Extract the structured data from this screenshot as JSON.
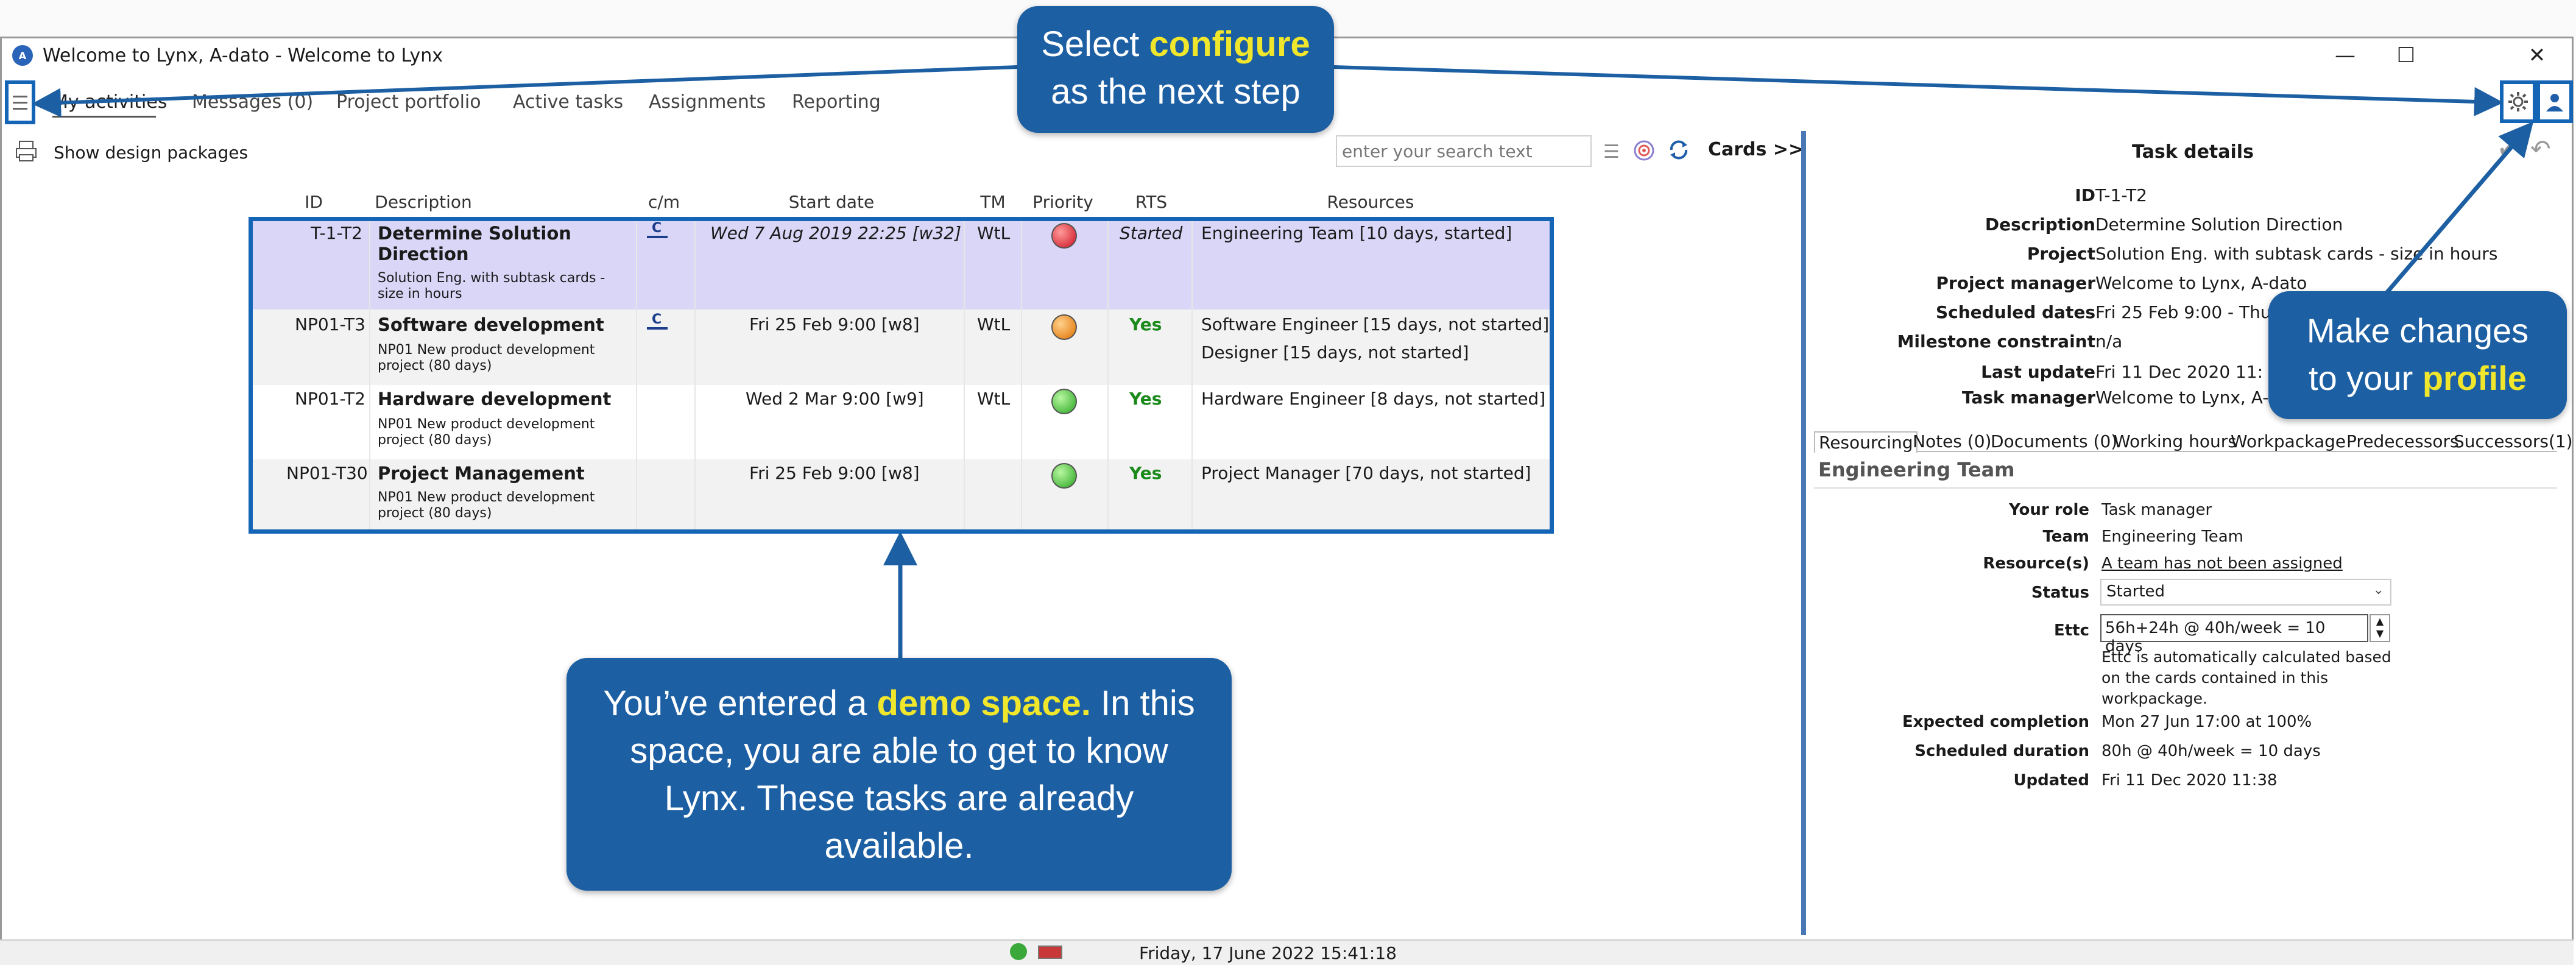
{
  "window": {
    "title": "Welcome to Lynx, A-dato - Welcome to Lynx",
    "logo": "lynx-logo",
    "controls": [
      "minimize-icon",
      "maximize-icon",
      "close-icon"
    ]
  },
  "tabs": [
    "My activities",
    "Messages (0)",
    "Project portfolio",
    "Active tasks",
    "Assignments",
    "Reporting"
  ],
  "toolbar": {
    "show_design_packages": "Show design packages",
    "search_placeholder": "enter your search text",
    "cards_link": "Cards >>"
  },
  "table": {
    "headers": [
      "ID",
      "Description",
      "c/m",
      "Start date",
      "TM",
      "Priority",
      "RTS",
      "Resources"
    ],
    "rows": [
      {
        "id": "T-1-T2",
        "title": "Determine Solution Direction",
        "subtitle": "Solution Eng. with subtask cards - size in hours",
        "cm": "C",
        "start": "Wed 7 Aug 2019 22:25 [w32]",
        "tm": "WtL",
        "priority": "red",
        "rts": "Started",
        "resources": [
          "Engineering Team [10 days, started]"
        ]
      },
      {
        "id": "NP01-T3",
        "title": "Software development",
        "subtitle": "NP01 New product development project (80 days)",
        "cm": "C",
        "start": "Fri 25 Feb 9:00 [w8]",
        "tm": "WtL",
        "priority": "orange",
        "rts": "Yes",
        "resources": [
          "Software Engineer [15 days, not started]",
          "Designer [15 days, not started]"
        ]
      },
      {
        "id": "NP01-T2",
        "title": "Hardware development",
        "subtitle": "NP01 New product development project (80 days)",
        "cm": "",
        "start": "Wed 2 Mar 9:00 [w9]",
        "tm": "WtL",
        "priority": "green",
        "rts": "Yes",
        "resources": [
          "Hardware Engineer [8 days, not started]"
        ]
      },
      {
        "id": "NP01-T30",
        "title": "Project Management",
        "subtitle": "NP01 New product development project (80 days)",
        "cm": "",
        "start": "Fri 25 Feb 9:00 [w8]",
        "tm": "",
        "priority": "green",
        "rts": "Yes",
        "resources": [
          "Project Manager [70 days, not started]"
        ]
      }
    ]
  },
  "details": {
    "title": "Task details",
    "fields": [
      {
        "label": "ID",
        "value": "T-1-T2"
      },
      {
        "label": "Description",
        "value": "Determine Solution Direction"
      },
      {
        "label": "Project",
        "value": "Solution Eng. with subtask cards - size in hours"
      },
      {
        "label": "Project manager",
        "value": "Welcome to Lynx, A-dato"
      },
      {
        "label": "Scheduled dates",
        "value": "Fri 25 Feb 9:00 - Thu 10"
      },
      {
        "label": "Milestone constraint",
        "value": "n/a"
      },
      {
        "label": "Last update",
        "value": "Fri 11 Dec 2020 11:"
      },
      {
        "label": "Task manager",
        "value": "Welcome to Lynx, A-da"
      }
    ],
    "subtabs": [
      "Resourcing",
      "Notes (0)",
      "Documents (0)",
      "Working hours",
      "Workpackage",
      "Predecessors",
      "Successors(1)"
    ],
    "team_heading": "Engineering Team",
    "resourcing": {
      "your_role_label": "Your role",
      "your_role": "Task manager",
      "team_label": "Team",
      "team": "Engineering Team",
      "resources_label": "Resource(s)",
      "resources": "A team has not been assigned",
      "status_label": "Status",
      "status": "Started",
      "ettc_label": "Ettc",
      "ettc": "56h+24h @ 40h/week = 10 days",
      "ettc_note": "Ettc is automatically calculated based on the cards contained in this workpackage.",
      "expected_label": "Expected completion",
      "expected": "Mon 27 Jun 17:00 at 100%",
      "scheduled_label": "Scheduled duration",
      "scheduled": "80h @ 40h/week = 10 days",
      "updated_label": "Updated",
      "updated": "Fri 11 Dec 2020 11:38"
    }
  },
  "status_bar": {
    "datetime": "Friday, 17 June 2022 15:41:18"
  },
  "callouts": {
    "configure_a": "Select ",
    "configure_hl": "configure",
    "configure_b": "as the next step",
    "profile_a": "Make changes",
    "profile_b": "to your ",
    "profile_hl": "profile",
    "demo_a": "You’ve entered a ",
    "demo_hl": "demo space.",
    "demo_b": " In this space, you are able to get to know Lynx. These tasks are already available."
  },
  "colors": {
    "accent": "#1d5fa3",
    "highlight": "#f0e62c",
    "selected_row": "#d9d6f7"
  }
}
